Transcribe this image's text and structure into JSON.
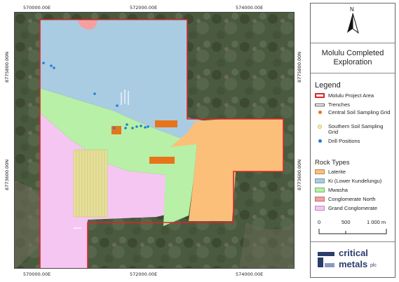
{
  "map": {
    "top_coords": [
      "570000.00E",
      "572000.00E",
      "574000.00E"
    ],
    "bottom_coords": [
      "570000.00E",
      "572000.00E",
      "574000.00E"
    ],
    "left_coords": [
      "8775800.00N",
      "8773600.00N"
    ],
    "right_coords": [
      "8775800.00N",
      "8773600.00N"
    ]
  },
  "north_arrow": {
    "label": "N"
  },
  "title": {
    "line1": "Molulu Completed",
    "line2": "Exploration"
  },
  "legend": {
    "heading": "Legend",
    "items": [
      {
        "label": "Molulu Project Area",
        "color": "#d62728"
      },
      {
        "label": "Trenches",
        "color": "#ffffff"
      },
      {
        "label": "Central Soil Sampling Grid",
        "color": "#e8741a"
      },
      {
        "label": "Southern Soil Sampling Grid",
        "color": "#e6e09a"
      },
      {
        "label": "Drill Positions",
        "color": "#1f7fd6"
      }
    ]
  },
  "rock_types": {
    "heading": "Rock Types",
    "items": [
      {
        "label": "Laterite",
        "color": "#fbbf7a"
      },
      {
        "label": "Ki (Lower Kundelungu)",
        "color": "#a9cce3"
      },
      {
        "label": "Mwasha",
        "color": "#b7f0a6"
      },
      {
        "label": "Conglomerate North",
        "color": "#f4a0a0"
      },
      {
        "label": "Grand Conglomerate",
        "color": "#f6c6f2"
      }
    ]
  },
  "scale_bar": {
    "labels": [
      "0",
      "500",
      "1 000 m"
    ]
  },
  "logo": {
    "line1": "critical",
    "line2": "metals",
    "suffix": "plc"
  }
}
